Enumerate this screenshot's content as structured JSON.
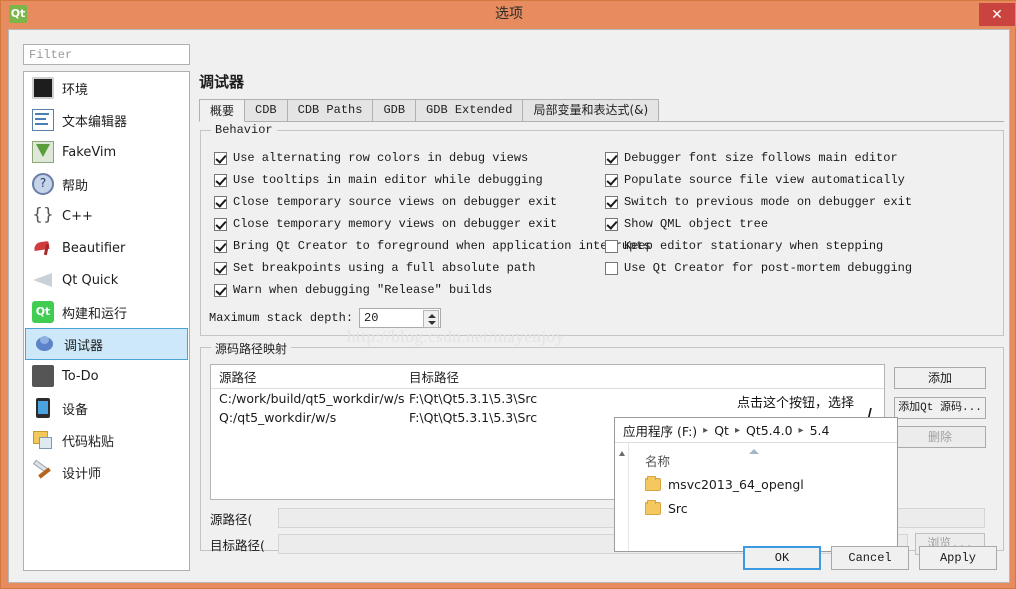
{
  "window": {
    "title": "选项",
    "app_icon": "qt-logo-icon",
    "close_label": "✕",
    "titlebar_color": "#e68c5f",
    "close_color": "#c9433f"
  },
  "sidebar": {
    "filter_placeholder": "Filter",
    "filter_value": "",
    "items": [
      {
        "label": "环境",
        "icon": "environment-icon",
        "selected": false
      },
      {
        "label": "文本编辑器",
        "icon": "text-editor-icon",
        "selected": false
      },
      {
        "label": "FakeVim",
        "icon": "fakevim-icon",
        "selected": false
      },
      {
        "label": "帮助",
        "icon": "help-icon",
        "selected": false
      },
      {
        "label": "C++",
        "icon": "cpp-icon",
        "selected": false
      },
      {
        "label": "Beautifier",
        "icon": "beautifier-icon",
        "selected": false
      },
      {
        "label": "Qt Quick",
        "icon": "qt-quick-icon",
        "selected": false
      },
      {
        "label": "构建和运行",
        "icon": "build-run-icon",
        "selected": false
      },
      {
        "label": "调试器",
        "icon": "debugger-icon",
        "selected": true
      },
      {
        "label": "To-Do",
        "icon": "todo-icon",
        "selected": false
      },
      {
        "label": "设备",
        "icon": "device-icon",
        "selected": false
      },
      {
        "label": "代码粘贴",
        "icon": "code-paste-icon",
        "selected": false
      },
      {
        "label": "设计师",
        "icon": "designer-icon",
        "selected": false
      }
    ],
    "selected_bg": "#cde8f8",
    "selected_border": "#4aa3d8"
  },
  "page": {
    "title": "调试器",
    "tabs": [
      {
        "label": "概要",
        "active": true,
        "cn": true
      },
      {
        "label": "CDB",
        "active": false,
        "cn": false
      },
      {
        "label": "CDB Paths",
        "active": false,
        "cn": false
      },
      {
        "label": "GDB",
        "active": false,
        "cn": false
      },
      {
        "label": "GDB Extended",
        "active": false,
        "cn": false
      },
      {
        "label": "局部变量和表达式(&)",
        "active": false,
        "cn": true
      }
    ]
  },
  "behavior": {
    "group_title": "Behavior",
    "left_checkboxes": [
      {
        "label": "Use alternating row colors in debug views",
        "checked": true
      },
      {
        "label": "Use tooltips in main editor while debugging",
        "checked": true
      },
      {
        "label": "Close temporary source views on debugger exit",
        "checked": true
      },
      {
        "label": "Close temporary memory views on debugger exit",
        "checked": true
      },
      {
        "label": "Bring Qt Creator to foreground when application interrupts",
        "checked": true
      },
      {
        "label": "Set breakpoints using a full absolute path",
        "checked": true
      },
      {
        "label": "Warn when debugging \"Release\" builds",
        "checked": true
      }
    ],
    "right_checkboxes": [
      {
        "label": "Debugger font size follows main editor",
        "checked": true
      },
      {
        "label": "Populate source file view automatically",
        "checked": true
      },
      {
        "label": "Switch to previous mode on debugger exit",
        "checked": true
      },
      {
        "label": "Show QML object tree",
        "checked": true
      },
      {
        "label": "Keep editor stationary when stepping",
        "checked": false
      },
      {
        "label": "Use Qt Creator for post-mortem debugging",
        "checked": false
      }
    ],
    "stack_depth_label": "Maximum stack depth:",
    "stack_depth_value": "20"
  },
  "source_map": {
    "group_title": "源码路径映射",
    "columns": [
      "源路径",
      "目标路径"
    ],
    "rows": [
      {
        "source": "C:/work/build/qt5_workdir/w/s",
        "target": "F:\\Qt\\Qt5.3.1\\5.3\\Src"
      },
      {
        "source": "Q:/qt5_workdir/w/s",
        "target": "F:\\Qt\\Qt5.3.1\\5.3\\Src"
      }
    ],
    "buttons": [
      {
        "label": "添加",
        "enabled": true,
        "mono": false
      },
      {
        "label": "添加Qt 源码...",
        "enabled": true,
        "mono": true
      },
      {
        "label": "删除",
        "enabled": false,
        "mono": false
      }
    ],
    "source_path_label": "源路径(",
    "source_path_value": "",
    "target_path_label": "目标路径(",
    "target_path_value": "",
    "browse_label": "浏览..."
  },
  "annotation": {
    "text": "点击这个按钮，选择",
    "watermark": "http://blog.csdn.net/mayenjoy"
  },
  "popup": {
    "breadcrumb": [
      "应用程序 (F:)",
      "Qt",
      "Qt5.4.0",
      "5.4"
    ],
    "separator": "▸",
    "column_header": "名称",
    "files": [
      {
        "name": "msvc2013_64_opengl",
        "icon": "folder-icon"
      },
      {
        "name": "Src",
        "icon": "folder-icon"
      }
    ]
  },
  "footer": {
    "buttons": [
      {
        "label": "OK",
        "default": true
      },
      {
        "label": "Cancel",
        "default": false
      },
      {
        "label": "Apply",
        "default": false
      }
    ]
  }
}
